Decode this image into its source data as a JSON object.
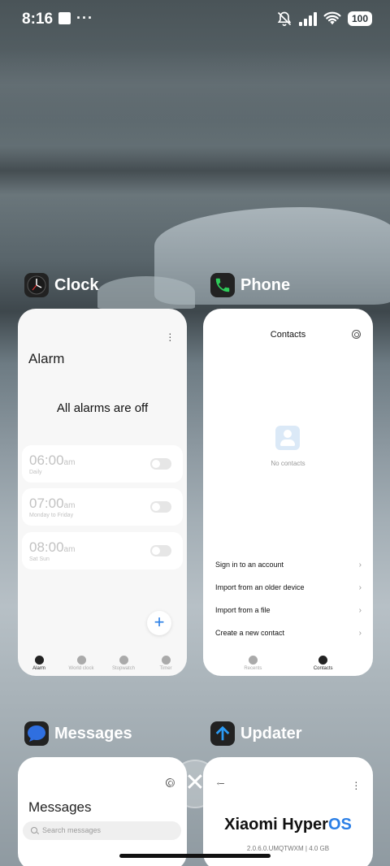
{
  "status_bar": {
    "time": "8:16",
    "battery": "100"
  },
  "apps": {
    "clock": {
      "label": "Clock",
      "title": "Alarm",
      "empty_text": "All alarms are off",
      "alarms": [
        {
          "time": "06:00",
          "ampm": "am",
          "repeat": "Daily"
        },
        {
          "time": "07:00",
          "ampm": "am",
          "repeat": "Monday to Friday"
        },
        {
          "time": "08:00",
          "ampm": "am",
          "repeat": "Sat Sun"
        }
      ],
      "add_label": "+",
      "nav": [
        "Alarm",
        "World clock",
        "Stopwatch",
        "Timer"
      ]
    },
    "phone": {
      "label": "Phone",
      "title": "Contacts",
      "empty_text": "No contacts",
      "menu": [
        "Sign in to an account",
        "Import from an older device",
        "Import from a file",
        "Create a new contact"
      ],
      "chevron": "›",
      "nav": [
        "Recents",
        "Contacts"
      ]
    },
    "messages": {
      "label": "Messages",
      "title": "Messages",
      "search_placeholder": "Search messages"
    },
    "updater": {
      "label": "Updater",
      "brand": "Xiaomi Hyper",
      "brand_accent": "OS",
      "version": "2.0.6.0.UMQTWXM | 4.0 GB"
    }
  },
  "colors": {
    "accent": "#2b7fe6",
    "phone_icon_bg": "#1fa84a",
    "messages_icon_bg": "#2f6fe0",
    "updater_icon_bg": "#222"
  },
  "icons": [
    "bell-muted-icon",
    "signal-icon",
    "wifi-icon",
    "battery-icon",
    "close-icon"
  ]
}
